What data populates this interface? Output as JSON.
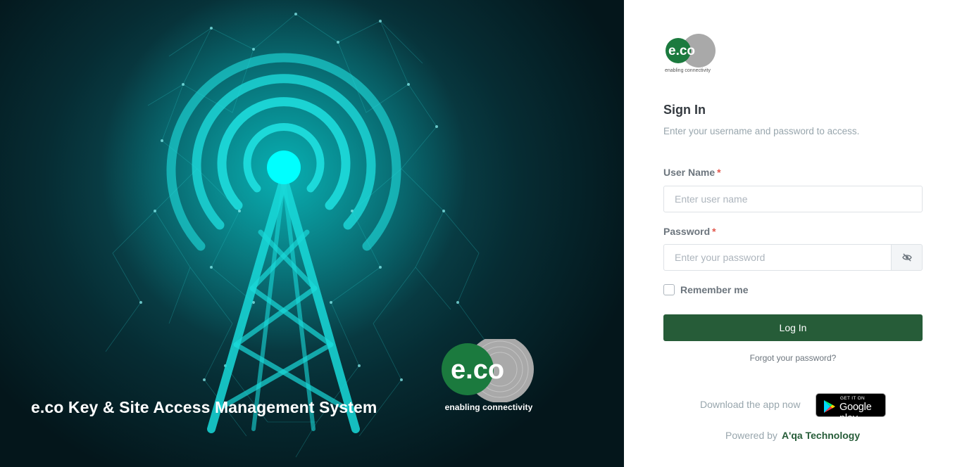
{
  "hero": {
    "title": "e.co Key & Site Access Management System",
    "logo_tagline": "enabling connectivity"
  },
  "brand": {
    "tagline": "enabling connectivity"
  },
  "signin": {
    "title": "Sign In",
    "subtitle": "Enter your username and password to access."
  },
  "form": {
    "username": {
      "label": "User Name",
      "required_mark": "*",
      "placeholder": "Enter user name",
      "value": ""
    },
    "password": {
      "label": "Password",
      "required_mark": "*",
      "placeholder": "Enter your password",
      "value": "",
      "toggle_icon": "eye-slash-icon"
    },
    "remember_label": "Remember me",
    "remember_checked": false,
    "login_label": "Log In",
    "forgot_label": "Forgot your password?"
  },
  "footer": {
    "download_text": "Download the app now",
    "store_small": "GET IT ON",
    "store_big": "Google play",
    "powered_text": "Powered by",
    "powered_link": "A'qa Technology"
  },
  "colors": {
    "accent": "#265c38",
    "hero_glow": "#00e5e5",
    "logo_green": "#1b7a3e",
    "logo_grey": "#a9a9a9"
  }
}
